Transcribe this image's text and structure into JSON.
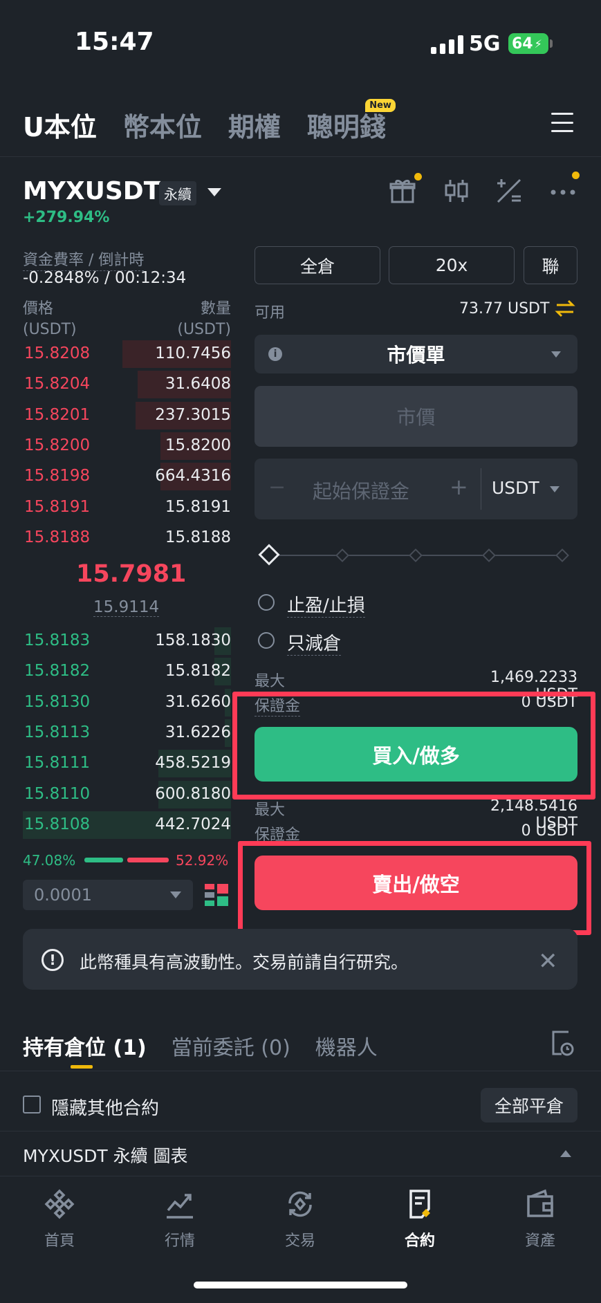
{
  "status_bar": {
    "time": "15:47",
    "network": "5G",
    "battery": "64"
  },
  "top_tabs": [
    {
      "label": "U本位",
      "active": true
    },
    {
      "label": "幣本位",
      "active": false
    },
    {
      "label": "期權",
      "active": false
    },
    {
      "label": "聰明錢",
      "active": false,
      "badge": "New"
    }
  ],
  "symbol": {
    "name": "MYXUSDT",
    "type": "永續",
    "change": "+279.94%"
  },
  "funding": {
    "label": "資金費率 / 倒計時",
    "value": "-0.2848% / 00:12:34"
  },
  "orderbook": {
    "price_header": "價格",
    "price_unit": "(USDT)",
    "qty_header": "數量",
    "qty_unit": "(USDT)",
    "asks": [
      {
        "price": "15.8208",
        "qty": "110.7456",
        "depth": 0.52
      },
      {
        "price": "15.8204",
        "qty": "31.6408",
        "depth": 0.45
      },
      {
        "price": "15.8201",
        "qty": "237.3015",
        "depth": 0.46
      },
      {
        "price": "15.8200",
        "qty": "15.8200",
        "depth": 0.34
      },
      {
        "price": "15.8198",
        "qty": "664.4316",
        "depth": 0.34
      },
      {
        "price": "15.8191",
        "qty": "15.8191",
        "depth": 0.0
      },
      {
        "price": "15.8188",
        "qty": "15.8188",
        "depth": 0.0
      }
    ],
    "last_price": "15.7981",
    "mark_price": "15.9114",
    "bids": [
      {
        "price": "15.8183",
        "qty": "158.1830",
        "depth": 0.08
      },
      {
        "price": "15.8182",
        "qty": "15.8182",
        "depth": 0.08
      },
      {
        "price": "15.8130",
        "qty": "31.6260",
        "depth": 0.03
      },
      {
        "price": "15.8113",
        "qty": "31.6226",
        "depth": 0.03
      },
      {
        "price": "15.8111",
        "qty": "458.5219",
        "depth": 0.35
      },
      {
        "price": "15.8110",
        "qty": "600.8180",
        "depth": 0.35
      },
      {
        "price": "15.8108",
        "qty": "442.7024",
        "depth": 1.0
      }
    ],
    "buy_ratio": "47.08%",
    "sell_ratio": "52.92%",
    "precision": "0.0001"
  },
  "order_form": {
    "margin_mode": "全倉",
    "leverage": "20x",
    "position_mode": "聯",
    "available_label": "可用",
    "available_value": "73.77 USDT",
    "order_type": "市價單",
    "price_placeholder": "市價",
    "margin_placeholder": "起始保證金",
    "minus": "−",
    "plus": "+",
    "margin_unit": "USDT",
    "tpsl_label": "止盈/止損",
    "reduce_only_label": "只減倉",
    "buy": {
      "max_label": "最大",
      "max_value": "1,469.2233 USDT",
      "margin_label": "保證金",
      "margin_value": "0 USDT",
      "button": "買入/做多"
    },
    "sell": {
      "max_label": "最大",
      "max_value": "2,148.5416 USDT",
      "margin_label": "保證金",
      "margin_value": "0 USDT",
      "button": "賣出/做空"
    }
  },
  "warning": {
    "text": "此幣種具有高波動性。交易前請自行研究。",
    "close": "✕"
  },
  "position_tabs": [
    {
      "label": "持有倉位 (1)",
      "active": true
    },
    {
      "label": "當前委託 (0)",
      "active": false
    },
    {
      "label": "機器人",
      "active": false
    }
  ],
  "positions": {
    "hide_label": "隱藏其他合約",
    "close_all": "全部平倉",
    "symbol_line": "MYXUSDT 永續  圖表"
  },
  "bottom_nav": [
    {
      "label": "首頁",
      "icon": "home-icon",
      "active": false
    },
    {
      "label": "行情",
      "icon": "markets-icon",
      "active": false
    },
    {
      "label": "交易",
      "icon": "trade-icon",
      "active": false
    },
    {
      "label": "合約",
      "icon": "futures-icon",
      "active": true
    },
    {
      "label": "資產",
      "icon": "wallet-icon",
      "active": false
    }
  ],
  "colors": {
    "background": "#1e2329",
    "red": "#f6465d",
    "green": "#2ebd85",
    "accent": "#f0b90b",
    "highlight": "#ff3b56"
  }
}
